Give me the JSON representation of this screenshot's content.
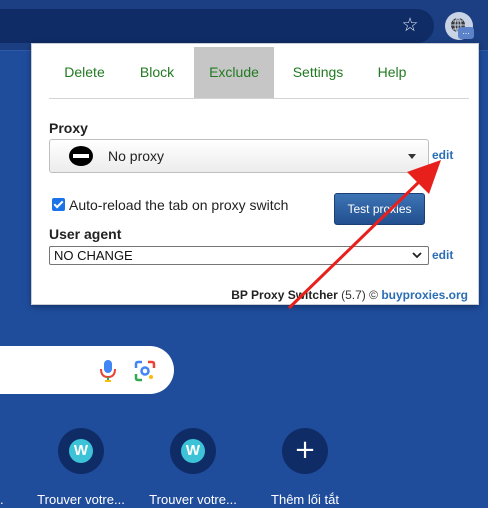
{
  "browser": {
    "star_icon": "star-icon",
    "extension_icon": "proxy-extension-icon",
    "extension_badge": "..."
  },
  "popup": {
    "tabs": [
      {
        "label": "Delete",
        "active": false
      },
      {
        "label": "Block",
        "active": false
      },
      {
        "label": "Exclude",
        "active": true
      },
      {
        "label": "Settings",
        "active": false
      },
      {
        "label": "Help",
        "active": false
      }
    ],
    "proxy_label": "Proxy",
    "proxy_value": "No proxy",
    "edit_label": "edit",
    "auto_reload_label": "Auto-reload the tab on proxy switch",
    "auto_reload_checked": true,
    "test_button_label": "Test proxies",
    "user_agent_label": "User agent",
    "user_agent_value": "NO CHANGE",
    "footer": {
      "brand": "BP Proxy Switcher",
      "version": "(5.7)",
      "copyright": "©",
      "site": "buyproxies.org"
    }
  },
  "newtab": {
    "shortcuts": [
      {
        "label": "Trouver votre...",
        "icon": "w-logo-icon"
      },
      {
        "label": "Trouver votre...",
        "icon": "w-logo-icon"
      },
      {
        "label": "Thêm lối tắt",
        "icon": "plus-icon"
      }
    ],
    "partial_label": "."
  },
  "colors": {
    "page_bg": "#1f4d9c",
    "tab_text": "#217a21",
    "link": "#2a6eb5",
    "arrow": "#e8201c"
  }
}
